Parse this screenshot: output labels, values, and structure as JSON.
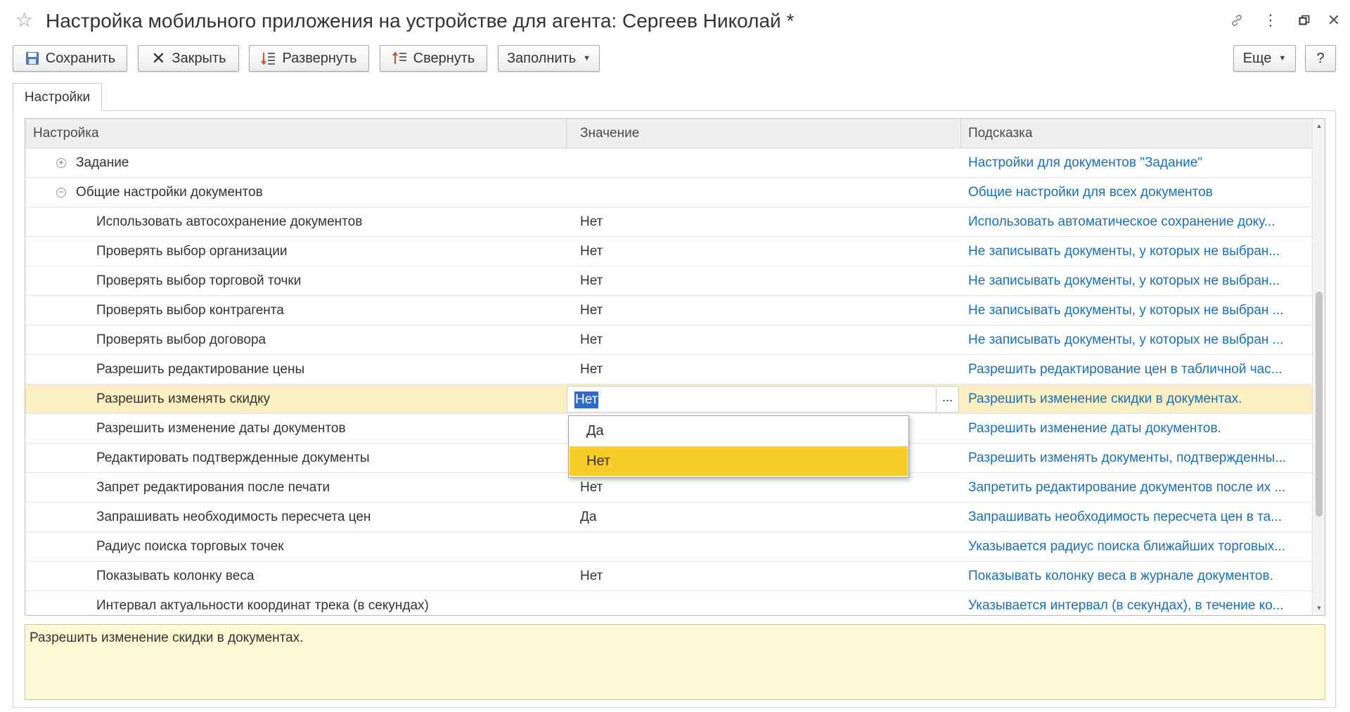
{
  "window": {
    "title": "Настройка мобильного приложения на устройстве для агента: Сергеев Николай *"
  },
  "toolbar": {
    "save": "Сохранить",
    "close": "Закрыть",
    "expand": "Развернуть",
    "collapse": "Свернуть",
    "fill": "Заполнить",
    "more": "Еще",
    "help": "?"
  },
  "tabs": {
    "settings": "Настройки"
  },
  "table": {
    "headers": {
      "setting": "Настройка",
      "value": "Значение",
      "hint": "Подсказка"
    },
    "rows": [
      {
        "setting": "Задание",
        "value": "",
        "hint": "Настройки для документов \"Задание\""
      },
      {
        "setting": "Общие настройки документов",
        "value": "",
        "hint": "Общие настройки для всех документов"
      },
      {
        "setting": "Использовать автосохранение документов",
        "value": "Нет",
        "hint": "Использовать автоматическое сохранение доку..."
      },
      {
        "setting": "Проверять выбор организации",
        "value": "Нет",
        "hint": "Не записывать документы, у которых не выбран..."
      },
      {
        "setting": "Проверять выбор торговой точки",
        "value": "Нет",
        "hint": "Не записывать документы, у которых не выбран..."
      },
      {
        "setting": "Проверять выбор контрагента",
        "value": "Нет",
        "hint": "Не записывать документы, у которых не выбран ..."
      },
      {
        "setting": "Проверять выбор договора",
        "value": "Нет",
        "hint": "Не записывать документы, у которых не выбран ..."
      },
      {
        "setting": "Разрешить редактирование цены",
        "value": "Нет",
        "hint": "Разрешить редактирование цен в табличной час..."
      },
      {
        "setting": "Разрешить изменять скидку",
        "value": "Нет",
        "hint": "Разрешить изменение скидки в документах."
      },
      {
        "setting": "Разрешить изменение даты документов",
        "value": "",
        "hint": "Разрешить изменение даты документов."
      },
      {
        "setting": "Редактировать подтвержденные документы",
        "value": "",
        "hint": "Разрешить изменять документы, подтвержденны..."
      },
      {
        "setting": "Запрет редактирования после печати",
        "value": "Нет",
        "hint": "Запретить редактирование документов после их ..."
      },
      {
        "setting": "Запрашивать необходимость пересчета цен",
        "value": "Да",
        "hint": "Запрашивать необходимость пересчета цен в та..."
      },
      {
        "setting": "Радиус поиска торговых точек",
        "value": "",
        "hint": "Указывается радиус поиска ближайших торговых..."
      },
      {
        "setting": "Показывать колонку веса",
        "value": "Нет",
        "hint": "Показывать колонку веса в журнале документов."
      },
      {
        "setting": "Интервал актуальности координат трека (в секундах)",
        "value": "",
        "hint": "Указывается интервал (в секундах), в течение ко..."
      }
    ]
  },
  "dropdown": {
    "options": [
      "Да",
      "Нет"
    ],
    "selected": "Нет"
  },
  "hint_panel": {
    "text": "Разрешить изменение скидки в документах."
  },
  "colors": {
    "accent_yellow": "#f7cd2b",
    "selected_row": "#fbf0c4",
    "link_blue": "#1b6fb5",
    "hint_bg": "#fdf9d4"
  }
}
